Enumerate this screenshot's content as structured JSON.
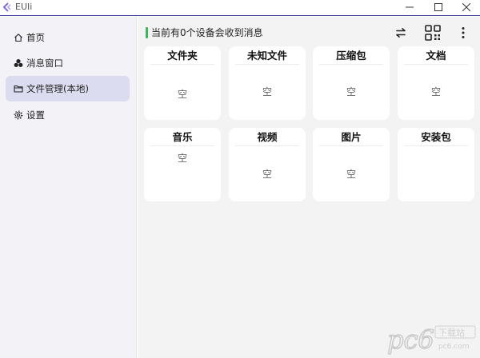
{
  "window": {
    "title": "EUIi",
    "colors": {
      "titlebar_border": "#3b3b9a",
      "sidebar_bg": "#f2f2f7",
      "sidebar_active_bg": "#dcdcf0",
      "main_bg": "#f3f3f3",
      "card_bg": "#ffffff",
      "status_accent": "#3cb55e"
    },
    "controls": {
      "minimize_icon": "minimize-icon",
      "maximize_icon": "maximize-icon",
      "close_icon": "close-icon"
    }
  },
  "sidebar": {
    "items": [
      {
        "label": "首页",
        "icon": "home-icon",
        "active": false
      },
      {
        "label": "消息窗口",
        "icon": "message-bubbles-icon",
        "active": false
      },
      {
        "label": "文件管理(本地)",
        "icon": "folder-icon",
        "active": true
      },
      {
        "label": "设置",
        "icon": "gear-icon",
        "active": false
      }
    ]
  },
  "main": {
    "status_text": "当前有0个设备会收到消息",
    "toolbar": {
      "swap_icon": "swap-arrows-icon",
      "qr_icon": "qr-code-icon",
      "more_icon": "more-vertical-icon"
    },
    "categories": [
      {
        "title": "文件夹",
        "empty_text": "空"
      },
      {
        "title": "未知文件",
        "empty_text": "空"
      },
      {
        "title": "压缩包",
        "empty_text": "空"
      },
      {
        "title": "文档",
        "empty_text": "空"
      },
      {
        "title": "音乐",
        "empty_text": "空"
      },
      {
        "title": "视频",
        "empty_text": "空"
      },
      {
        "title": "图片",
        "empty_text": "空"
      },
      {
        "title": "安装包",
        "empty_text": ""
      }
    ]
  },
  "watermark": {
    "text": "pc6",
    "subtext": "下载站",
    "domain": "pc6.com"
  }
}
